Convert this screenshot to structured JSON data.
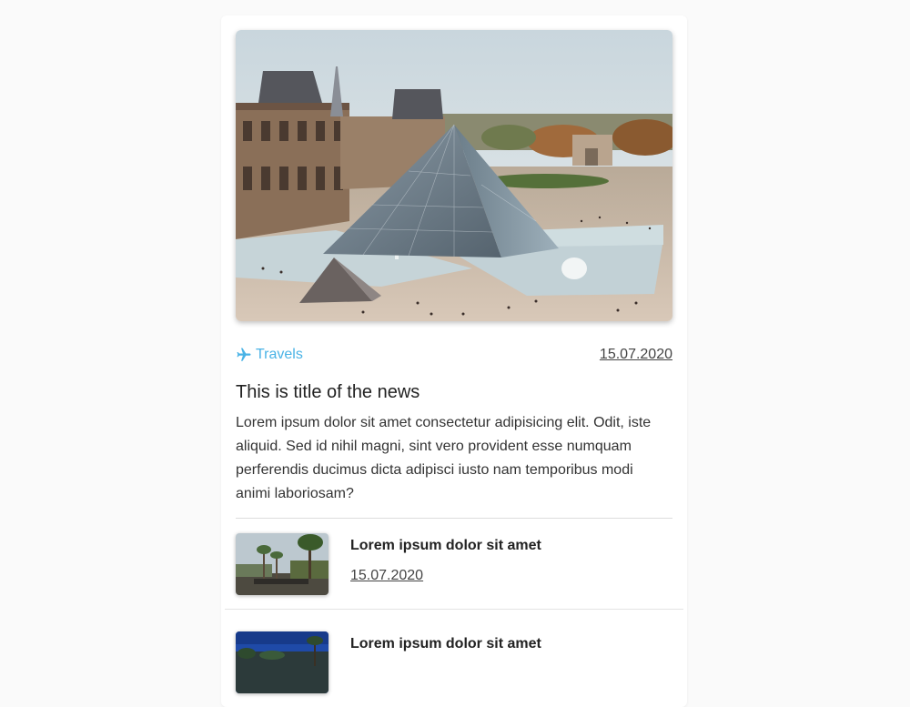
{
  "article": {
    "category": "Travels",
    "category_icon": "airplane-icon",
    "date": "15.07.2020",
    "title": "This is title of the news",
    "excerpt": "Lorem ipsum dolor sit amet consectetur adipisicing elit. Odit, iste aliquid. Sed id nihil magni, sint vero provident esse numquam perferendis ducimus dicta adipisci iusto nam temporibus modi animi laboriosam?",
    "hero_image": "louvre-pyramid-photo"
  },
  "related": [
    {
      "title": "Lorem ipsum dolor sit amet",
      "date": "15.07.2020",
      "image": "palm-street-photo"
    },
    {
      "title": "Lorem ipsum dolor sit amet",
      "date": "",
      "image": "palm-blue-sky-photo"
    }
  ],
  "colors": {
    "accent": "#4ab3e6",
    "background": "#fafafa",
    "card": "#ffffff",
    "text": "#333333"
  }
}
